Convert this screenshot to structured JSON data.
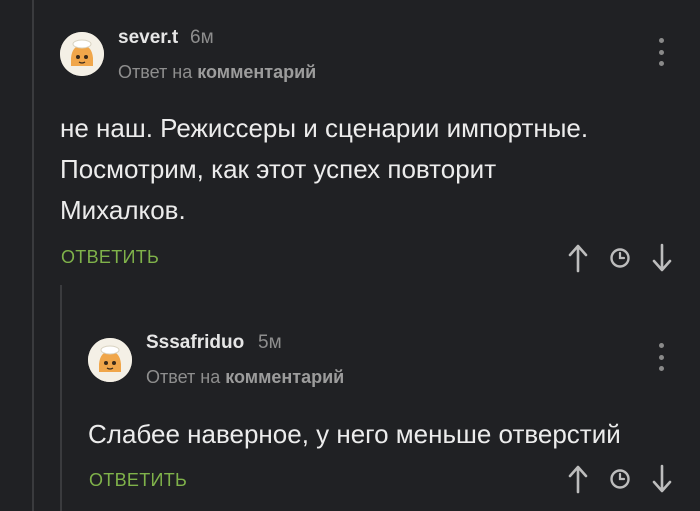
{
  "comments": [
    {
      "username": "sever.t",
      "time": "6м",
      "reply_prefix": "Ответ на",
      "reply_target": "комментарий",
      "text_lines": [
        "не наш.  Режиссеры и сценарии импортные.",
        "Посмотрим, как этот успех повторит",
        "Михалков."
      ],
      "reply_label": "ОТВЕТИТЬ",
      "avatar_icon": "cartoon-avatar-icon",
      "actions": [
        "arrow-up-icon",
        "clock-icon",
        "arrow-down-icon"
      ]
    },
    {
      "username": "Sssafriduo",
      "time": "5м",
      "reply_prefix": "Ответ на",
      "reply_target": "комментарий",
      "text_lines": [
        "Слабее наверное, у него меньше отверстий"
      ],
      "reply_label": "ОТВЕТИТЬ",
      "avatar_icon": "cartoon-avatar-icon",
      "actions": [
        "arrow-up-icon",
        "clock-icon",
        "arrow-down-icon"
      ]
    }
  ],
  "colors": {
    "background": "#202124",
    "accent": "#7fb24a",
    "muted": "#8e8e8e"
  }
}
